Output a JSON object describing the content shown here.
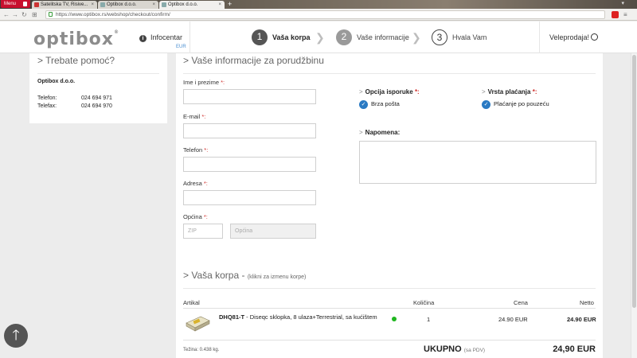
{
  "browser": {
    "menu_label": "Menu",
    "tabs": [
      {
        "title": "Satelitska TV, Risive..."
      },
      {
        "title": "Optibox d.o.o."
      },
      {
        "title": "Optibox d.o.o."
      }
    ],
    "new_tab": "+",
    "url": "https://www.optibox.rs/webshop/checkout/confirm/"
  },
  "header": {
    "logo": "optibox",
    "logo_reg": "®",
    "infocentar": "Infocentar",
    "currency": "EUR",
    "steps": [
      {
        "num": "1",
        "label": "Vaša korpa"
      },
      {
        "num": "2",
        "label": "Vaše informacije"
      },
      {
        "num": "3",
        "label": "Hvala Vam"
      }
    ],
    "veleprodaja": "Veleprodaja!"
  },
  "sidebar": {
    "title": "> Trebate pomoć?",
    "company": "Optibox d.o.o.",
    "phone_label": "Telefon:",
    "phone": "024 694 971",
    "fax_label": "Telefax:",
    "fax": "024 694 970"
  },
  "form": {
    "title": "> Vaše informacije za porudžbinu",
    "name_label": "Ime i prezime",
    "email_label": "E-mail",
    "phone_label": "Telefon",
    "address_label": "Adresa",
    "municipality_label": "Općina",
    "required_mark": "*:",
    "zip_placeholder": "ZIP",
    "municipality_placeholder": "Općina",
    "delivery_title": "Opcija isporuke",
    "delivery_option": "Brza pošta",
    "payment_title": "Vrsta plaćanja",
    "payment_option": "Plaćanje po pouzeću",
    "notes_title": "Napomena:",
    "gt": ">"
  },
  "cart": {
    "title": "> Vaša korpa -",
    "subtitle": "(klikni za izmenu korpe)",
    "headers": {
      "article": "Artikal",
      "quantity": "Količina",
      "price": "Cena",
      "net": "Netto"
    },
    "items": [
      {
        "code": "DHQ81-T",
        "description": " - Diseqc sklopka, 8 ulaza+Terrestrial, sa kućištem",
        "quantity": "1",
        "price": "24.90 EUR",
        "net": "24.90 EUR"
      }
    ],
    "weight": "Težina: 0.438 kg.",
    "total_label": "UKUPNO",
    "total_note": "(sa PDV)",
    "total_value": "24,90 EUR"
  },
  "colors": {
    "accent": "#2a7ac3",
    "required": "#d0312d",
    "in_stock": "#1fb61f"
  }
}
